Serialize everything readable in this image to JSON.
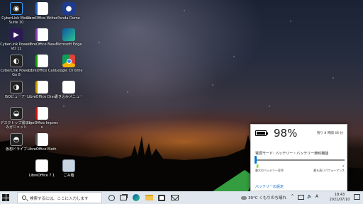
{
  "desktop": {
    "icons": [
      {
        "label": "CyberLink Media Suite 10"
      },
      {
        "label": "CyberLink PowerDVD 12"
      },
      {
        "label": "CyberLink Power2Go 8"
      },
      {
        "label": "ISOビューアー"
      },
      {
        "label": "デスクトップ書き込みガジェット"
      },
      {
        "label": "仮想ドライブ"
      },
      {
        "label": "LibreOffice Writer"
      },
      {
        "label": "LibreOffice Base"
      },
      {
        "label": "LibreOffice Calc"
      },
      {
        "label": "LibreOffice Draw"
      },
      {
        "label": "LibreOffice Impress"
      },
      {
        "label": "LibreOffice Math"
      },
      {
        "label": "LibreOffice 7.1"
      },
      {
        "label": "Panda Dome"
      },
      {
        "label": "Microsoft Edge"
      },
      {
        "label": "Google Chrome"
      },
      {
        "label": "書き込みメニュー"
      },
      {
        "label": "ごみ箱"
      }
    ]
  },
  "battery": {
    "percent_text": "98%",
    "percent_value": 98,
    "remaining": "残り 8 時間 46 分",
    "mode_label": "電源モード: バッテリー・バッテリー節約機能",
    "slider_left_end": "🔋",
    "slider_right_end": "⚡",
    "slider_left_caption": "最大のバッテリー寿命",
    "slider_right_caption": "最も高いパフォーマンス",
    "slider_position": 0,
    "settings_link": "バッテリーの設定"
  },
  "taskbar": {
    "search_placeholder": "検索するには、ここに入力します",
    "weather": "30°C くもりのち晴れ",
    "tray_chevron": "^",
    "tray_ime": "A",
    "tray_volume": "🔈",
    "time": "18:43",
    "date": "2021/07/10"
  },
  "colors": {
    "accent": "#0078d4",
    "link": "#0067c0",
    "taskbar_bg": "#dfe6ee"
  }
}
